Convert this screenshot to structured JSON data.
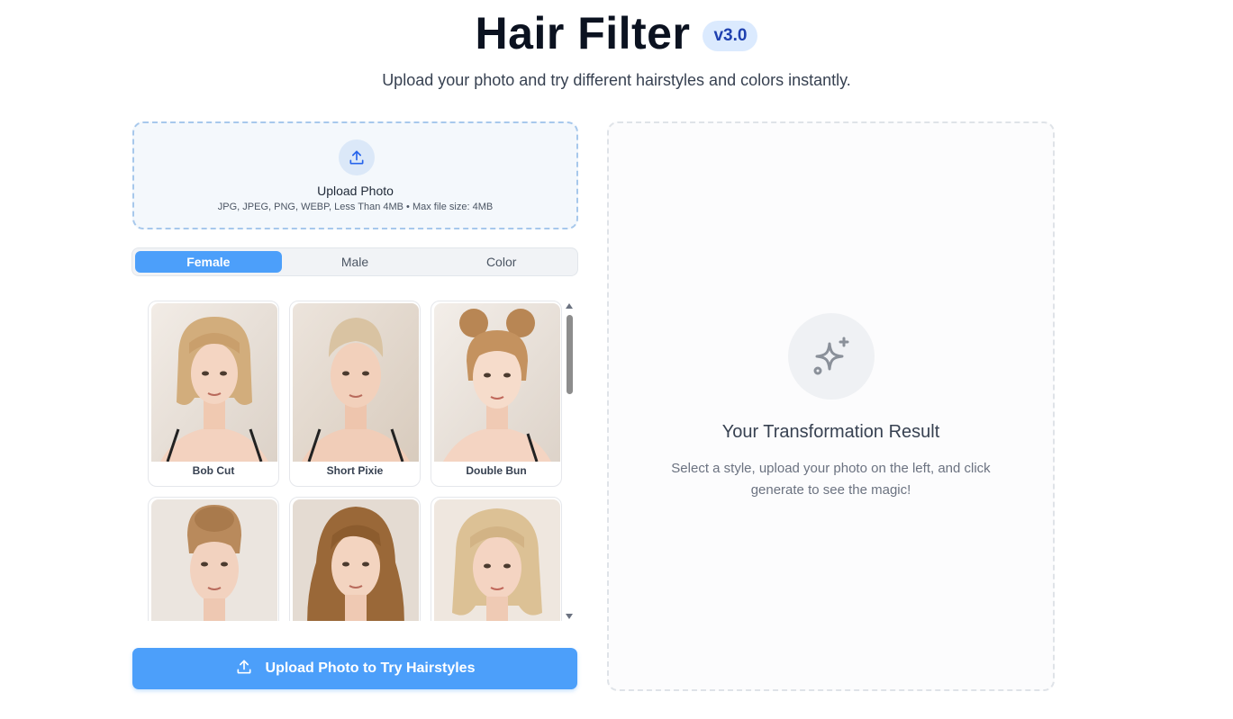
{
  "header": {
    "title": "Hair Filter",
    "version": "v3.0",
    "subtitle": "Upload your photo and try different hairstyles and colors instantly."
  },
  "upload": {
    "icon": "upload-icon",
    "title": "Upload Photo",
    "formats": "JPG, JPEG, PNG, WEBP, Less Than 4MB • Max file size: 4MB"
  },
  "tabs": [
    {
      "label": "Female",
      "active": true
    },
    {
      "label": "Male",
      "active": false
    },
    {
      "label": "Color",
      "active": false
    }
  ],
  "styles": [
    {
      "label": "Bob Cut"
    },
    {
      "label": "Short Pixie"
    },
    {
      "label": "Double Bun"
    },
    {
      "label": ""
    },
    {
      "label": ""
    },
    {
      "label": ""
    }
  ],
  "main_button": {
    "label": "Upload Photo to Try Hairstyles",
    "icon": "upload-icon"
  },
  "result": {
    "icon": "sparkles-icon",
    "title": "Your Transformation Result",
    "description": "Select a style, upload your photo on the left, and click generate to see the magic!"
  },
  "colors": {
    "accent": "#4c9ffa",
    "version_bg": "#dbeafe"
  }
}
